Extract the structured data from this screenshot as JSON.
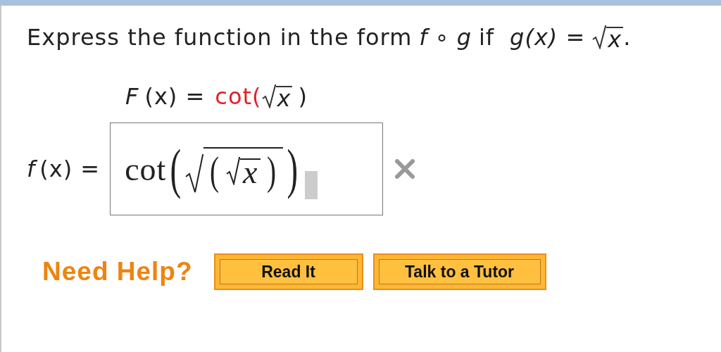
{
  "question": {
    "prompt": "Express the function in the form",
    "f": "f",
    "circ": "∘",
    "g": "g",
    "if": "if",
    "gx": "g",
    "gx_rest": "(x) =",
    "radicand": "x",
    "period": "."
  },
  "given": {
    "lhs": "F",
    "lhs_rest": "(x) =",
    "func": "cot(",
    "radicand": "x",
    "close": ")"
  },
  "answer": {
    "label": "f",
    "label_rest": "(x) =",
    "func": "cot",
    "open": "(",
    "inner_open": "(",
    "radicand": "x",
    "inner_close": ")",
    "close": ")",
    "correct": false
  },
  "help": {
    "label": "Need Help?",
    "buttons": [
      "Read It",
      "Talk to a Tutor"
    ]
  }
}
